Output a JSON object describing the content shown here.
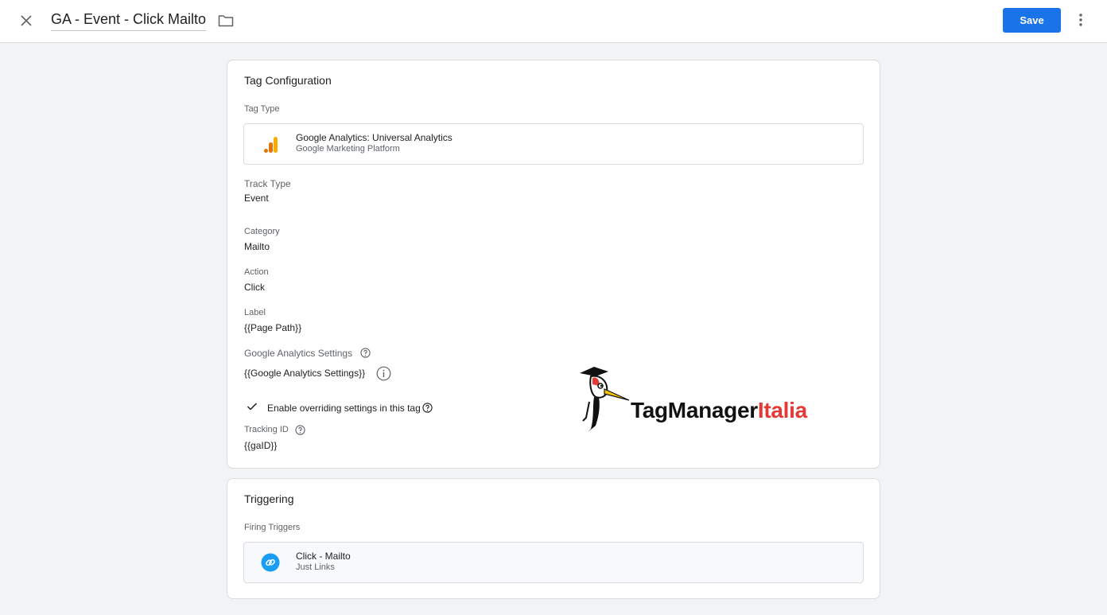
{
  "header": {
    "title": "GA - Event - Click Mailto",
    "save_label": "Save"
  },
  "tag_config": {
    "title": "Tag Configuration",
    "tag_type_label": "Tag Type",
    "tag_type": {
      "name": "Google Analytics: Universal Analytics",
      "vendor": "Google Marketing Platform"
    },
    "fields": [
      {
        "label": "Track Type",
        "value": "Event"
      },
      {
        "label": "Category",
        "value": "Mailto"
      },
      {
        "label": "Action",
        "value": "Click"
      },
      {
        "label": "Label",
        "value": "{{Page Path}}"
      }
    ],
    "ga_settings_label": "Google Analytics Settings",
    "ga_settings_value": "{{Google Analytics Settings}}",
    "override_label": "Enable overriding settings in this tag",
    "override_checked": true,
    "tracking_id_label": "Tracking ID",
    "tracking_id_value": "{{gaID}}"
  },
  "triggering": {
    "title": "Triggering",
    "firing_label": "Firing Triggers",
    "trigger": {
      "name": "Click - Mailto",
      "type": "Just Links"
    }
  },
  "watermark": {
    "text_dark": "TagManager",
    "text_red": "Italia"
  },
  "colors": {
    "primary": "#1a73e8",
    "analytics_orange": "#f9ab00",
    "analytics_dark_orange": "#e37400",
    "trigger_blue": "#1a9ef5",
    "brand_red": "#e53935"
  }
}
